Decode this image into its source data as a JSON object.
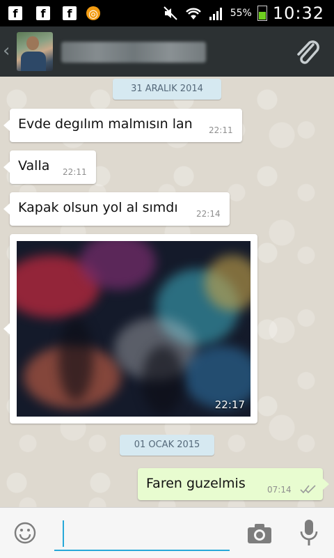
{
  "status_bar": {
    "notification_icons": [
      "facebook-icon",
      "facebook-icon",
      "facebook-icon",
      "alarm-icon"
    ],
    "battery": "55%",
    "battery_level": 0.55,
    "time": "10:32"
  },
  "header": {
    "back_glyph": "‹",
    "contact_name": "",
    "attach_icon": "paperclip-icon"
  },
  "chat": {
    "date_separators": [
      "31 ARALIK 2014",
      "01 OCAK 2015"
    ],
    "messages": [
      {
        "direction": "incoming",
        "text": "Evde degılım malmısın lan",
        "time": "22:11"
      },
      {
        "direction": "incoming",
        "text": "Valla",
        "time": "22:11"
      },
      {
        "direction": "incoming",
        "text": "Kapak olsun yol al sımdı",
        "time": "22:14"
      },
      {
        "direction": "incoming",
        "type": "image",
        "time": "22:17"
      },
      {
        "direction": "outgoing",
        "text": "Faren guzelmis",
        "time": "07:14",
        "status": "read"
      }
    ]
  },
  "compose": {
    "emoji_icon": "smiley-icon",
    "input_value": "",
    "camera_icon": "camera-icon",
    "mic_icon": "microphone-icon"
  },
  "colors": {
    "header_bg": "#2c3133",
    "chat_bg": "#ded9cf",
    "incoming_bubble": "#ffffff",
    "outgoing_bubble": "#e8fcd0",
    "date_pill": "#d6e9f1",
    "accent": "#27a8d8"
  }
}
